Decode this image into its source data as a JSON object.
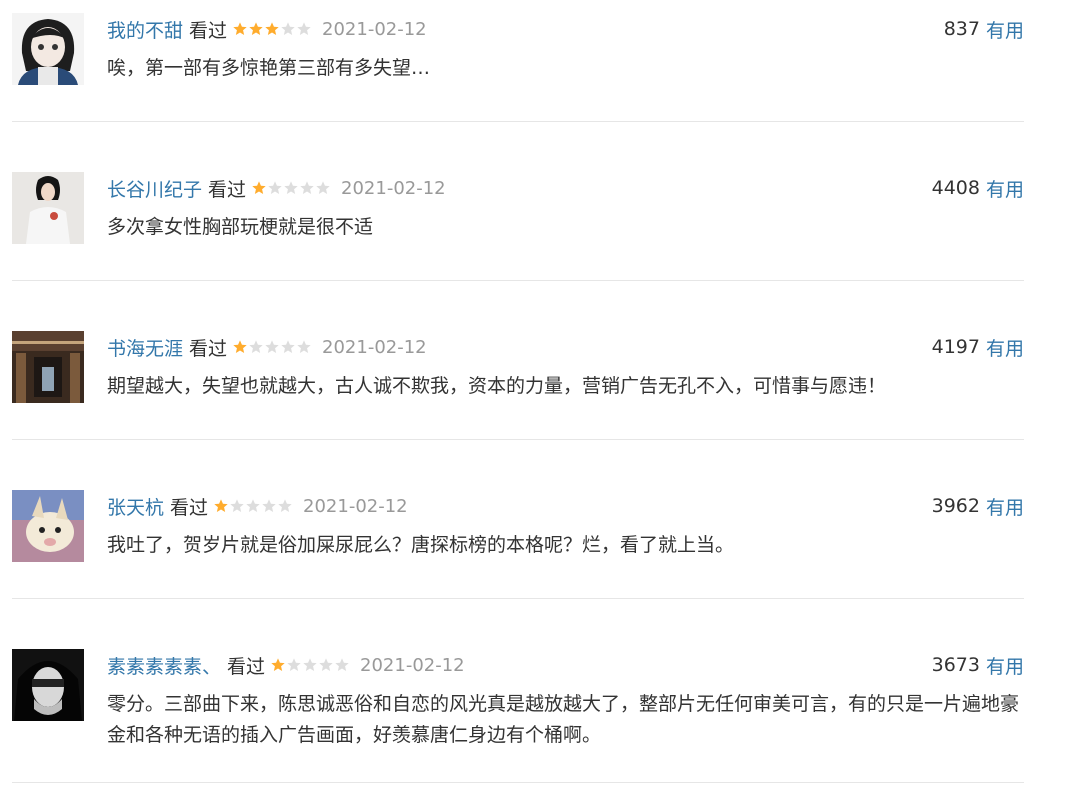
{
  "accent": "#3377aa",
  "star_color": "#ffac2d",
  "star_empty_color": "#dddddd",
  "comments": [
    {
      "user": "我的不甜",
      "status": "看过",
      "rating": 3,
      "date": "2021-02-12",
      "votes": "837",
      "useful_label": "有用",
      "text": "唉，第一部有多惊艳第三部有多失望…",
      "avatar_icon": "anime-girl-avatar"
    },
    {
      "user": "长谷川纪子",
      "status": "看过",
      "rating": 1,
      "date": "2021-02-12",
      "votes": "4408",
      "useful_label": "有用",
      "text": "多次拿女性胸部玩梗就是很不适",
      "avatar_icon": "woman-photo-avatar"
    },
    {
      "user": "书海无涯",
      "status": "看过",
      "rating": 1,
      "date": "2021-02-12",
      "votes": "4197",
      "useful_label": "有用",
      "text": "期望越大，失望也就越大，古人诚不欺我，资本的力量，营销广告无孔不入，可惜事与愿违！",
      "avatar_icon": "library-photo-avatar"
    },
    {
      "user": "张天杭",
      "status": "看过",
      "rating": 1,
      "date": "2021-02-12",
      "votes": "3962",
      "useful_label": "有用",
      "text": "我吐了，贺岁片就是俗加屎尿屁么？唐探标榜的本格呢？烂，看了就上当。",
      "avatar_icon": "plush-toy-avatar"
    },
    {
      "user": "素素素素素、",
      "status": "看过",
      "rating": 1,
      "date": "2021-02-12",
      "votes": "3673",
      "useful_label": "有用",
      "text": "零分。三部曲下来，陈思诚恶俗和自恋的风光真是越放越大了，整部片无任何审美可言，有的只是一片遍地豪金和各种无语的插入广告画面，好羡慕唐仁身边有个桶啊。",
      "avatar_icon": "bw-portrait-avatar"
    }
  ]
}
